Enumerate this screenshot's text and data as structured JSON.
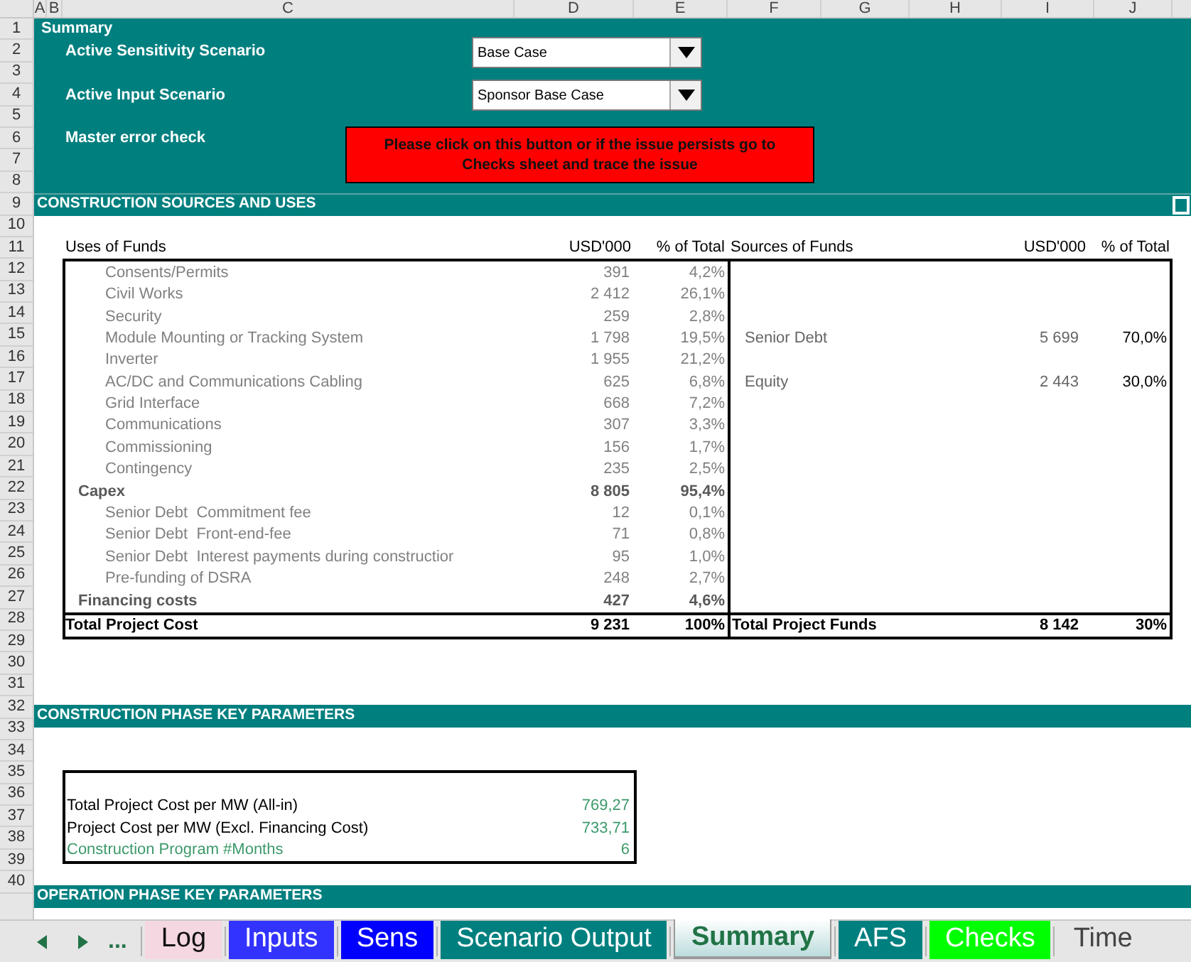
{
  "columns": [
    "A",
    "B",
    "C",
    "D",
    "E",
    "F",
    "G",
    "H",
    "I",
    "J"
  ],
  "row_numbers": [
    "1",
    "2",
    "3",
    "4",
    "5",
    "6",
    "7",
    "8",
    "9",
    "10",
    "11",
    "12",
    "13",
    "14",
    "15",
    "16",
    "17",
    "18",
    "19",
    "20",
    "21",
    "22",
    "23",
    "24",
    "25",
    "26",
    "27",
    "28",
    "29",
    "30",
    "31",
    "32",
    "33",
    "34",
    "35",
    "36",
    "37",
    "38",
    "39",
    "40"
  ],
  "summary": {
    "title": "Summary",
    "fields": [
      {
        "label": "Active Sensitivity Scenario",
        "value": "Base Case"
      },
      {
        "label": "Active Input Scenario",
        "value": "Sponsor Base Case"
      }
    ],
    "error_check": {
      "label": "Master error check",
      "button": "Please click on this button or if the issue persists go to Checks sheet and trace the issue"
    }
  },
  "sections": [
    "CONSTRUCTION SOURCES AND USES",
    "CONSTRUCTION PHASE KEY PARAMETERS",
    "OPERATION PHASE KEY PARAMETERS"
  ],
  "uses": {
    "columns": [
      "Uses of Funds",
      "USD'000",
      "% of Total"
    ],
    "groups": [
      {
        "label": "Capex",
        "value": "8 805",
        "pct": "95,4%",
        "children": [
          {
            "label": "Consents/Permits",
            "value": "391",
            "pct": "4,2%"
          },
          {
            "label": "Civil Works",
            "value": "2 412",
            "pct": "26,1%"
          },
          {
            "label": "Security",
            "value": "259",
            "pct": "2,8%"
          },
          {
            "label": "Module Mounting or Tracking System",
            "value": "1 798",
            "pct": "19,5%"
          },
          {
            "label": "Inverter",
            "value": "1 955",
            "pct": "21,2%"
          },
          {
            "label": "AC/DC and Communications Cabling",
            "value": "625",
            "pct": "6,8%"
          },
          {
            "label": "Grid Interface",
            "value": "668",
            "pct": "7,2%"
          },
          {
            "label": "Communications",
            "value": "307",
            "pct": "3,3%"
          },
          {
            "label": "Commissioning",
            "value": "156",
            "pct": "1,7%"
          },
          {
            "label": "Contingency",
            "value": "235",
            "pct": "2,5%"
          }
        ]
      },
      {
        "label": "Financing costs",
        "value": "427",
        "pct": "4,6%",
        "children": [
          {
            "label": "Senior Debt  Commitment fee",
            "value": "12",
            "pct": "0,1%"
          },
          {
            "label": "Senior Debt  Front-end-fee",
            "value": "71",
            "pct": "0,8%"
          },
          {
            "label": "Senior Debt  Interest payments during constructior",
            "value": "95",
            "pct": "1,0%"
          },
          {
            "label": "Pre-funding of DSRA",
            "value": "248",
            "pct": "2,7%"
          }
        ]
      }
    ],
    "total": {
      "label": "Total Project Cost",
      "value": "9 231",
      "pct": "100%"
    }
  },
  "sources": {
    "columns": [
      "Sources of Funds",
      "USD'000",
      "% of Total"
    ],
    "rows": [
      {
        "label": "Senior Debt",
        "value": "5 699",
        "pct": "70,0%"
      },
      {
        "label": "Equity",
        "value": "2 443",
        "pct": "30,0%"
      }
    ],
    "total": {
      "label": "Total Project Funds",
      "value": "8 142",
      "pct": "30%"
    }
  },
  "key_parameters": [
    {
      "label": "Total Project Cost per MW (All-in)",
      "value": "769,27",
      "kind": "calc"
    },
    {
      "label": "Project Cost per MW (Excl. Financing Cost)",
      "value": "733,71",
      "kind": "calc"
    },
    {
      "label": "Construction Program #Months",
      "value": "6",
      "kind": "input"
    }
  ],
  "sheet_nav": {
    "more": "..."
  },
  "tabs": [
    {
      "label": "Log",
      "selected": false,
      "color": "#f4d7e0"
    },
    {
      "label": "Inputs",
      "selected": false,
      "color": "#3333ff"
    },
    {
      "label": "Sens",
      "selected": false,
      "color": "#0000ff"
    },
    {
      "label": "Scenario Output",
      "selected": false,
      "color": "#007f7f"
    },
    {
      "label": "Summary",
      "selected": true
    },
    {
      "label": "AFS",
      "selected": false,
      "color": "#007f7f"
    },
    {
      "label": "Checks",
      "selected": false,
      "color": "#00ff00"
    },
    {
      "label": "Time",
      "selected": false
    }
  ]
}
